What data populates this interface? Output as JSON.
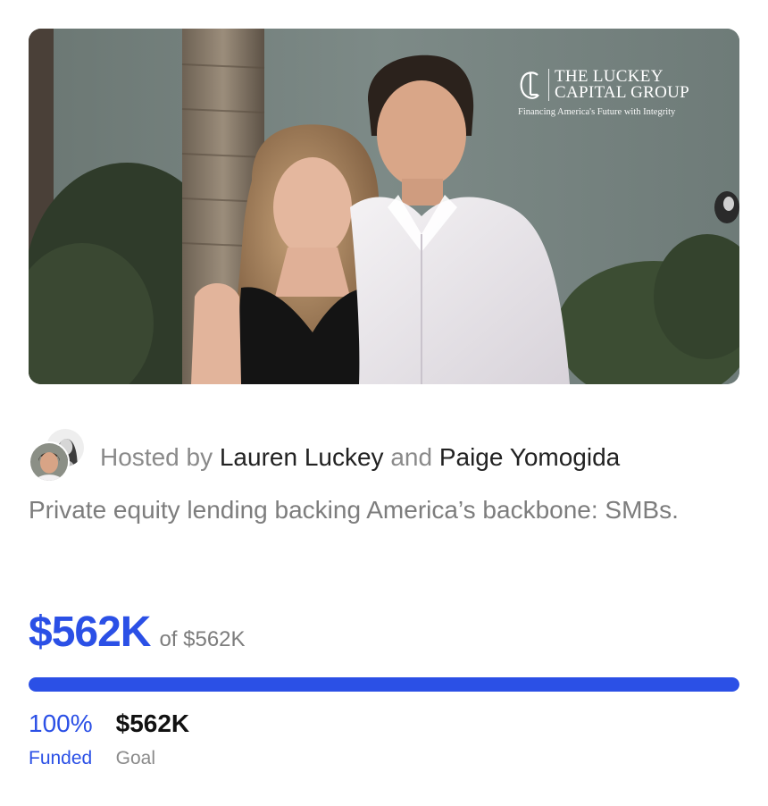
{
  "hero": {
    "image_alt": "Two women standing outdoors in front of a palm tree and hedges",
    "brand": {
      "line1": "THE LUCKEY",
      "line2": "CAPITAL GROUP",
      "tagline": "Financing America's Future with Integrity"
    }
  },
  "host": {
    "prefix": "Hosted by",
    "name1": "Lauren Luckey",
    "joiner": "and",
    "name2": "Paige Yomogida"
  },
  "description": "Private equity lending backing America’s backbone: SMBs.",
  "funding": {
    "raised": "$562K",
    "of_goal": "of $562K",
    "progress_fraction": 1.0,
    "funded_percent": "100%",
    "funded_label": "Funded",
    "goal_value": "$562K",
    "goal_label": "Goal"
  },
  "colors": {
    "accent": "#2b50e6",
    "muted_text": "#7d7d7d"
  }
}
